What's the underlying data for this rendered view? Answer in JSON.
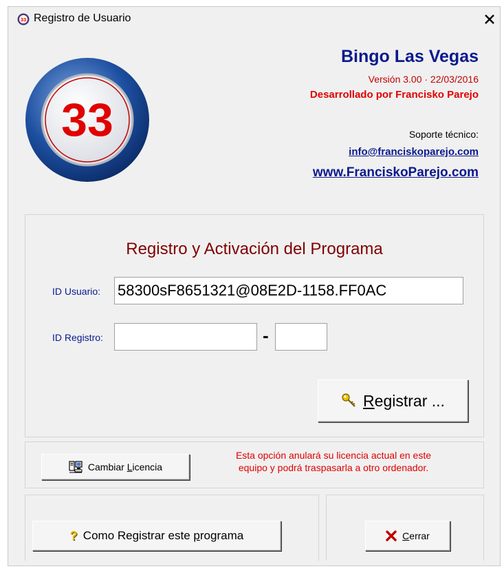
{
  "window": {
    "title": "Registro de Usuario",
    "close_glyph": "✕",
    "icon": "bingo-ball-33-icon"
  },
  "logo": {
    "number": "33",
    "colors": {
      "ring": "#1d4fa0",
      "inner": "#ffffff",
      "number": "#e00000"
    }
  },
  "info": {
    "app_name": "Bingo Las Vegas",
    "version": "Versión 3.00 · 22/03/2016",
    "developer": "Desarrollado por Francisko Parejo",
    "support_label": "Soporte técnico:",
    "email": "info@franciskoparejo.com",
    "website": "www.FranciskoParejo.com"
  },
  "registration": {
    "heading": "Registro y Activación del Programa",
    "user_id_label": "ID Usuario:",
    "user_id_value": "58300sF8651321@08E2D-1158.FF0AC",
    "reg_id_label": "ID Registro:",
    "reg_id_value_1": "",
    "reg_id_value_2": "",
    "dash": "-",
    "register_button_label": "Registrar ...",
    "register_button_access_key": "R",
    "register_button_rest": "egistrar ...",
    "register_icon": "key-icon"
  },
  "license": {
    "button_label_prefix": "Cambiar ",
    "button_label_access": "L",
    "button_label_rest": "icencia",
    "button_icon": "computer-network-icon",
    "note_line1": "Esta opción anulará su licencia actual en este",
    "note_line2": "equipo y podrá traspasarla a otro ordenador."
  },
  "footer": {
    "howto_prefix": "Como Registrar este ",
    "howto_access": "p",
    "howto_rest": "rograma",
    "howto_icon": "question-mark-icon",
    "close_access": "C",
    "close_rest": "errar",
    "close_icon": "red-x-icon"
  },
  "colors": {
    "dialog_bg": "#f0f0f0",
    "link_blue": "#0a1a8c",
    "red_text": "#e00000",
    "heading_maroon": "#800000"
  }
}
